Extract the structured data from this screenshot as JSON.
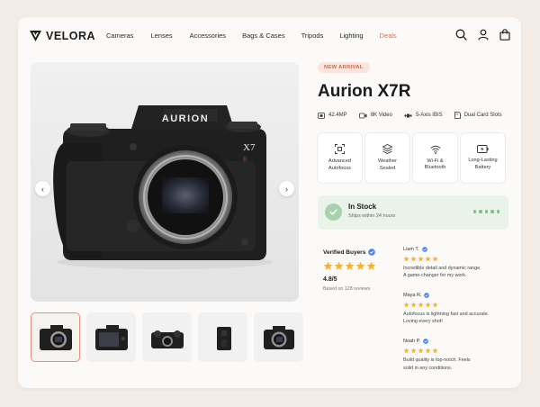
{
  "brand": {
    "name": "VELORA"
  },
  "nav": {
    "links": [
      {
        "label": "Cameras"
      },
      {
        "label": "Lenses"
      },
      {
        "label": "Accessories"
      },
      {
        "label": "Bags & Cases"
      },
      {
        "label": "Tripods"
      },
      {
        "label": "Lighting"
      },
      {
        "label": "Deals",
        "accent": "#d9714f"
      }
    ]
  },
  "gallery": {
    "camera_brand": "AURION",
    "camera_model": "X7",
    "camera_model_mark": "R",
    "thumbnail_count": 5
  },
  "product": {
    "badge": "NEW ARRIVAL",
    "title": "Aurion X7R",
    "specs": [
      {
        "icon": "sensor-icon",
        "label": "42.4MP"
      },
      {
        "icon": "video-icon",
        "label": "8K Video"
      },
      {
        "icon": "stabilization-icon",
        "label": "5-Axis IBIS"
      },
      {
        "icon": "card-slot-icon",
        "label": "Dual Card Slots"
      }
    ],
    "features": [
      {
        "icon": "autofocus-icon",
        "line1": "Advanced",
        "line2": "Autofocus"
      },
      {
        "icon": "weather-seal-icon",
        "line1": "Weather",
        "line2": "Sealed"
      },
      {
        "icon": "wifi-icon",
        "line1": "Wi-Fi &",
        "line2": "Bluetooth"
      },
      {
        "icon": "battery-icon",
        "line1": "Long-Lasting",
        "line2": "Battery"
      }
    ]
  },
  "stock": {
    "title": "In Stock",
    "subtitle": "Ships within 24 hours"
  },
  "reviews": {
    "heading": "Verified Buyers",
    "rating": "4.8/5",
    "based_on": "Based on 128 reviews",
    "stars": 5,
    "items": [
      {
        "name": "Liam T.",
        "stars": 5,
        "line1": "Incredible detail and dynamic range.",
        "line2": "A game-changer for my work."
      },
      {
        "name": "Maya R.",
        "stars": 5,
        "line1": "Autofocus is lightning fast and accurate.",
        "line2": "Loving every shot!"
      },
      {
        "name": "Noah P.",
        "stars": 5,
        "line1": "Build quality is top-notch. Feels",
        "line2": "solid in any conditions."
      }
    ]
  },
  "colors": {
    "accent": "#d9714f",
    "star": "#f2b33d",
    "stock_green": "#7fc088",
    "verified_blue": "#4a86e8"
  }
}
